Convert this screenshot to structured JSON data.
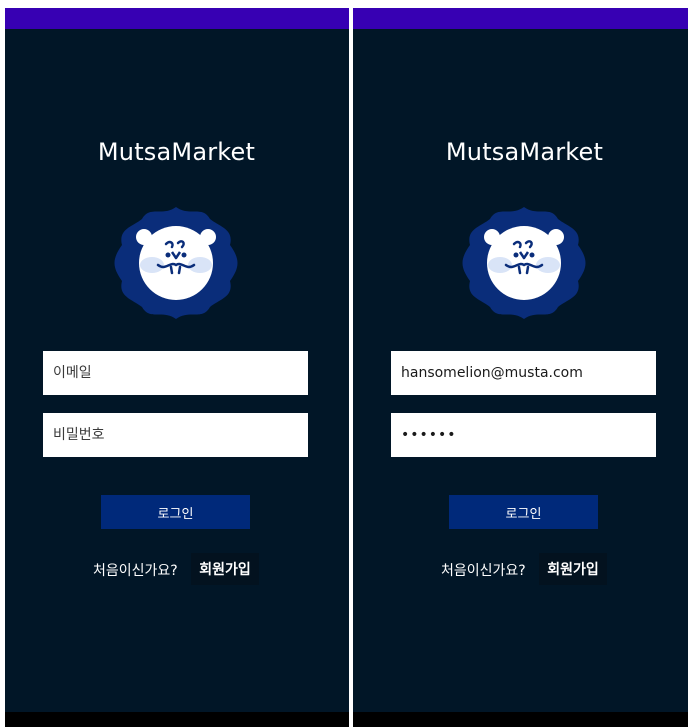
{
  "colors": {
    "status_bar": "#3700b3",
    "background": "#011627",
    "accent": "#00297a",
    "logo_badge": "#0a2d7a",
    "logo_face": "#ffffff",
    "text": "#ffffff"
  },
  "screens": [
    {
      "app_title": "MutsaMarket",
      "logo_icon": "lion-icon",
      "email": {
        "value": "",
        "placeholder": "이메일"
      },
      "password": {
        "value": "",
        "placeholder": "비밀번호"
      },
      "login_label": "로그인",
      "signup_prompt": "처음이신가요?",
      "signup_label": "회원가입"
    },
    {
      "app_title": "MutsaMarket",
      "logo_icon": "lion-icon",
      "email": {
        "value": "hansomelion@musta.com",
        "placeholder": "이메일"
      },
      "password": {
        "value": "••••••",
        "placeholder": "비밀번호"
      },
      "login_label": "로그인",
      "signup_prompt": "처음이신가요?",
      "signup_label": "회원가입"
    }
  ]
}
